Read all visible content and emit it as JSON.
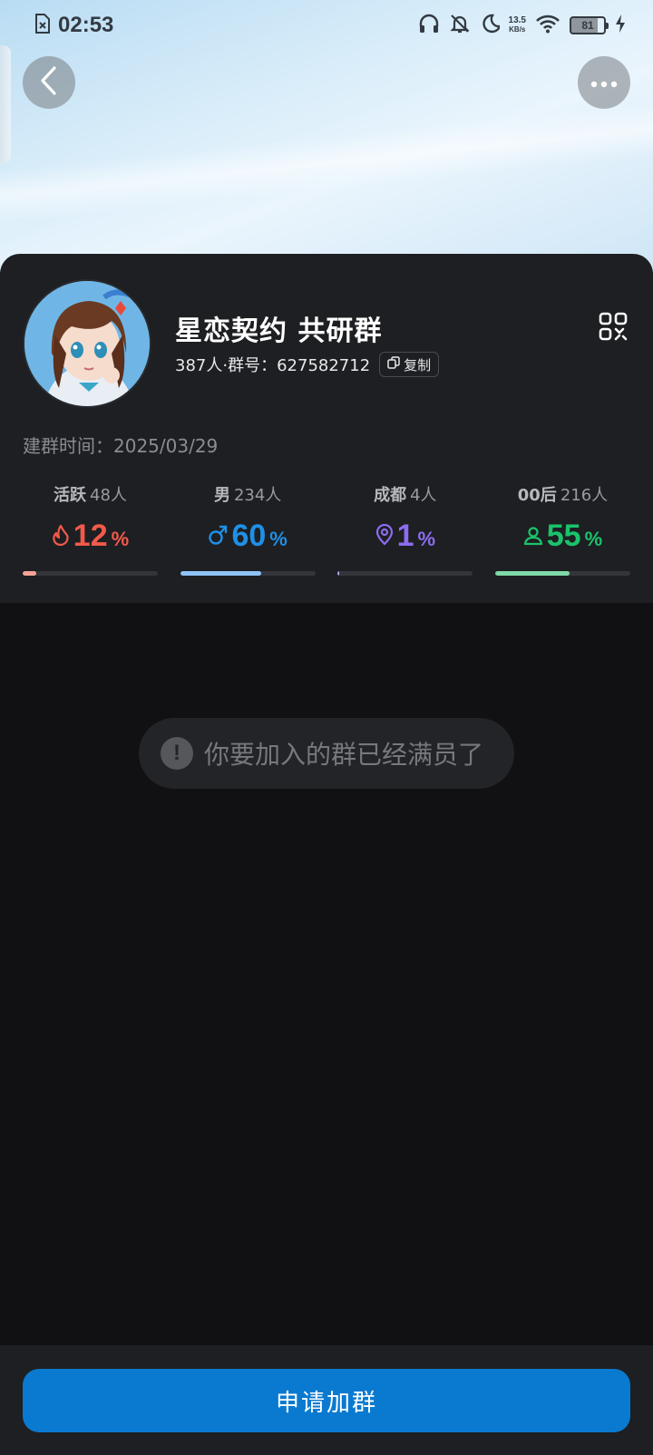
{
  "status_bar": {
    "time": "02:53",
    "net_speed_value": "13.5",
    "net_speed_unit": "KB/s",
    "battery": "81",
    "icons": [
      "file-x-icon",
      "headphones-icon",
      "bell-off-icon",
      "moon-icon",
      "wifi-icon",
      "battery-icon",
      "charging-icon"
    ]
  },
  "nav": {
    "back_icon": "chevron-left-icon",
    "more_icon": "more-dots-icon"
  },
  "group": {
    "name": "星恋契约 共研群",
    "members": "387人",
    "separator": "·",
    "id_label": "群号：",
    "id": "627582712",
    "copy_label": "复制",
    "created_label": "建群时间：",
    "created_date": "2025/03/29"
  },
  "stats": [
    {
      "label": "活跃",
      "count": "48人",
      "value": "12",
      "unit": "%",
      "icon": "flame-icon",
      "color": "#f2594b",
      "bar_color": "#f7a39a",
      "fill": 0.1
    },
    {
      "label": "男",
      "count": "234人",
      "value": "60",
      "unit": "%",
      "icon": "male-icon",
      "color": "#1e90e8",
      "bar_color": "#8ec4f7",
      "fill": 0.6
    },
    {
      "label": "成都",
      "count": "4人",
      "value": "1",
      "unit": "%",
      "icon": "location-pin-icon",
      "color": "#8c6df0",
      "bar_color": "#b8a6f5",
      "fill": 0.01
    },
    {
      "label": "00后",
      "count": "216人",
      "value": "55",
      "unit": "%",
      "icon": "person-icon",
      "color": "#19c46b",
      "bar_color": "#7fd9a8",
      "fill": 0.55
    }
  ],
  "toast": {
    "icon": "exclamation-icon",
    "message": "你要加入的群已经满员了"
  },
  "actions": {
    "apply_label": "申请加群"
  },
  "colors": {
    "accent": "#0a7ad0",
    "background": "#111113",
    "card": "#1e1f22"
  }
}
